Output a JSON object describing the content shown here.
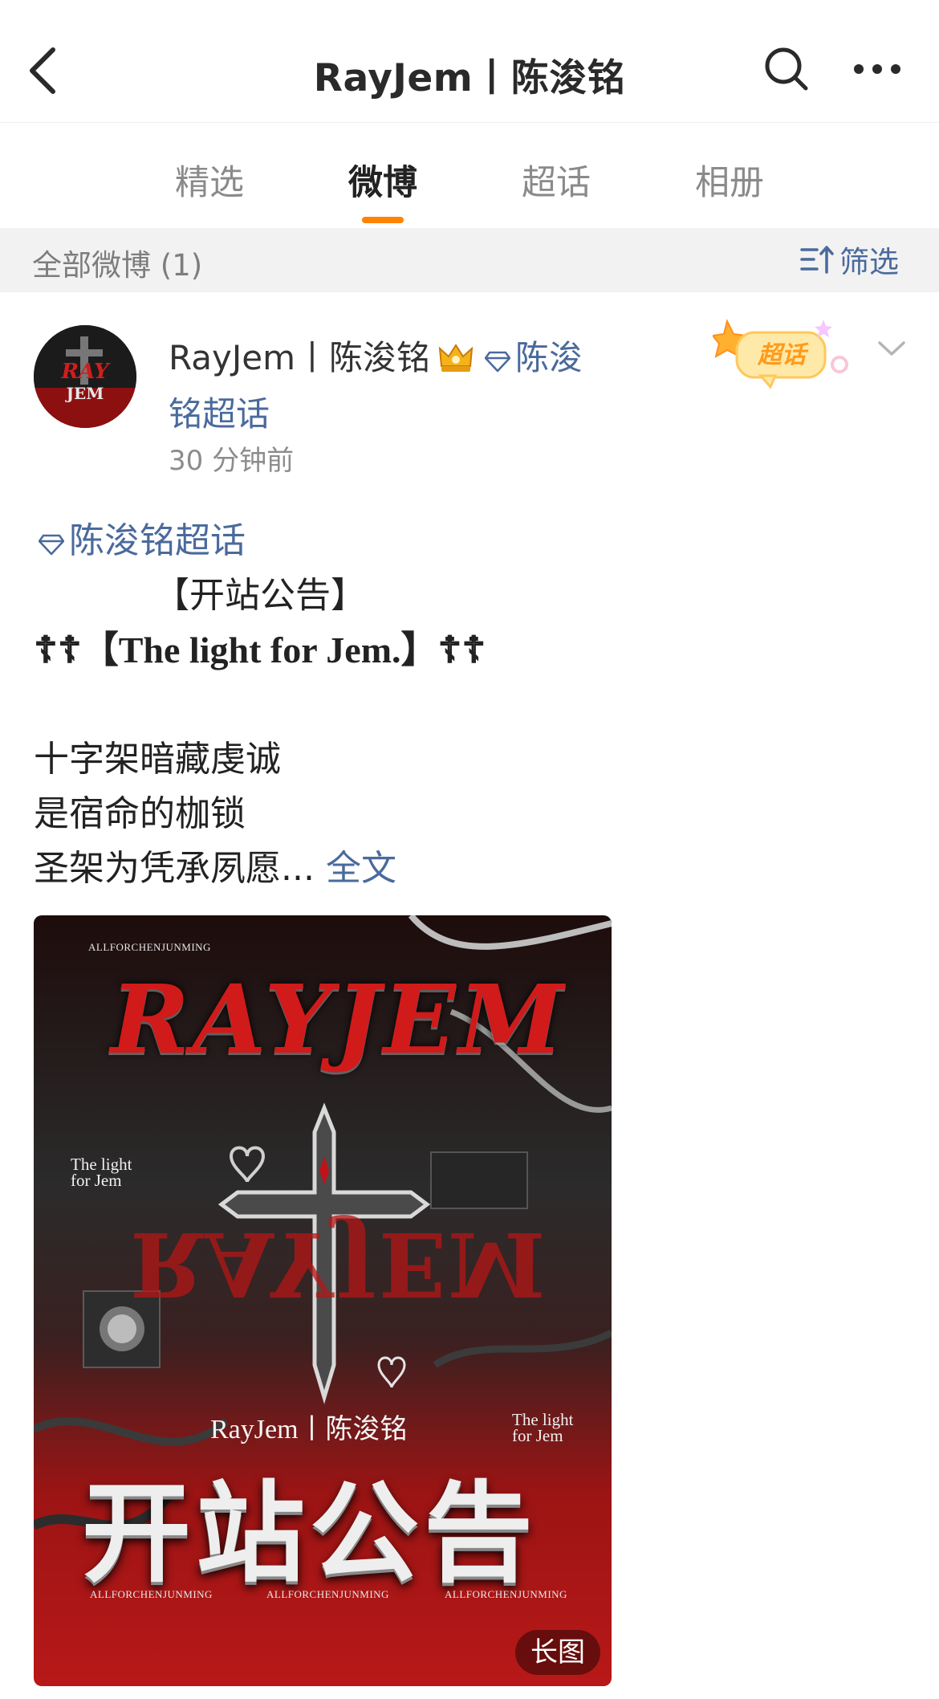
{
  "header": {
    "title": "RayJem丨陈浚铭"
  },
  "tabs": [
    {
      "label": "精选",
      "active": false
    },
    {
      "label": "微博",
      "active": true
    },
    {
      "label": "超话",
      "active": false
    },
    {
      "label": "相册",
      "active": false
    }
  ],
  "filter": {
    "count_label": "全部微博 (1)",
    "filter_label": "筛选"
  },
  "post": {
    "author": "RayJem丨陈浚铭",
    "topic_link_part1": "陈浚",
    "topic_link_part2": "铭超话",
    "time": "30 分钟前",
    "badge_label": "超话",
    "content": {
      "topic": "陈浚铭超话",
      "line1": "【开站公告】",
      "line2": "☦︎☦︎【The light for Jem.】☦︎☦︎",
      "line3": "十字架暗藏虔诚",
      "line4": "是宿命的枷锁",
      "line5": "圣架为凭承夙愿...",
      "fulltext_link": "全文"
    },
    "image": {
      "watermark_top": "ALLFORCHENJUNMING",
      "brand": "RAYJEM",
      "side_text_left": "The light for Jem",
      "side_text_right": "The light for Jem",
      "name_line": "RayJem丨陈浚铭",
      "headline": "开站公告",
      "watermark_bottom": [
        "ALLFORCHENJUNMING",
        "ALLFORCHENJUNMING",
        "ALLFORCHENJUNMING"
      ],
      "long_image_label": "长图"
    }
  },
  "colors": {
    "accent": "#ff8200",
    "link": "#4a6a9c",
    "filter_bg": "#f2f2f2"
  }
}
